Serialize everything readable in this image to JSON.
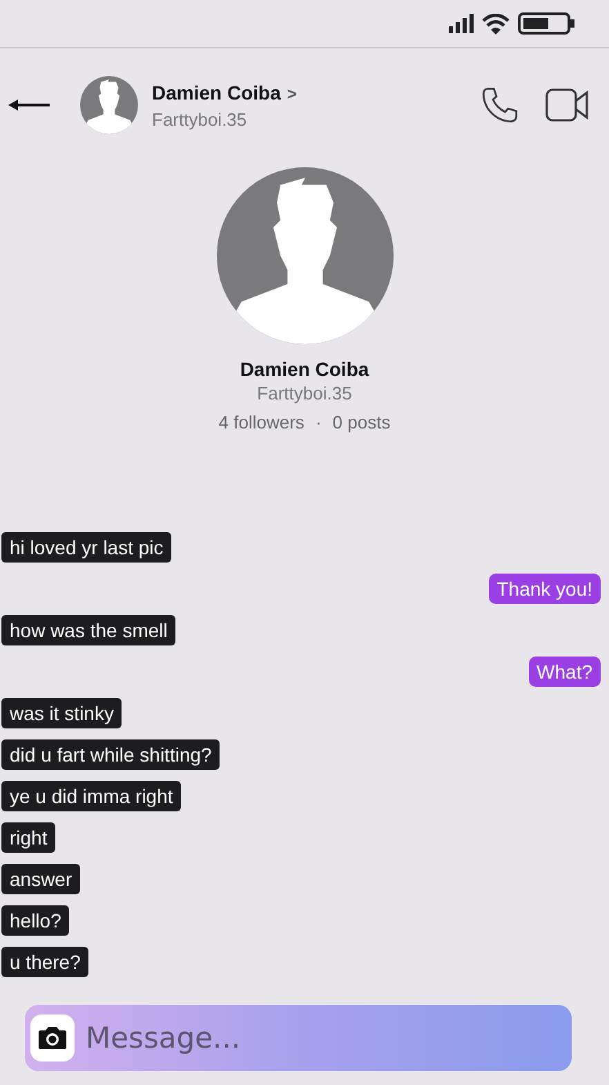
{
  "contact": {
    "name": "Damien Coiba",
    "chevron": ">",
    "handle": "Farttyboi.35"
  },
  "profile": {
    "name": "Damien Coiba",
    "handle": "Farttyboi.35",
    "followers": "4 followers",
    "separator": "·",
    "posts": "0 posts"
  },
  "messages": [
    {
      "kind": "received",
      "text": "hi loved yr last pic"
    },
    {
      "kind": "sent",
      "text": "Thank you!"
    },
    {
      "kind": "received",
      "text": "how was the smell"
    },
    {
      "kind": "sent",
      "text": "What?"
    },
    {
      "kind": "received",
      "text": "was it stinky"
    },
    {
      "kind": "received",
      "text": "did u fart while shitting?"
    },
    {
      "kind": "received",
      "text": "ye u did imma right"
    },
    {
      "kind": "received",
      "text": "right"
    },
    {
      "kind": "received",
      "text": "answer"
    },
    {
      "kind": "received",
      "text": "hello?"
    },
    {
      "kind": "received",
      "text": "u there?"
    }
  ],
  "composer": {
    "placeholder": "Message..."
  }
}
